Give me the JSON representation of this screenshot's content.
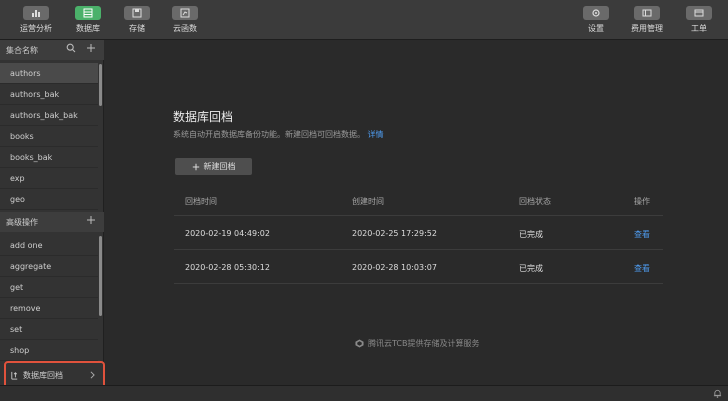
{
  "toolbar": {
    "left_buttons": [
      {
        "label": "运营分析",
        "icon": "bar-chart-icon",
        "active": false
      },
      {
        "label": "数据库",
        "icon": "database-icon",
        "active": true
      },
      {
        "label": "存储",
        "icon": "storage-icon",
        "active": false
      },
      {
        "label": "云函数",
        "icon": "function-icon",
        "active": false
      }
    ],
    "right_buttons": [
      {
        "label": "设置",
        "icon": "gear-icon"
      },
      {
        "label": "费用管理",
        "icon": "billing-icon"
      },
      {
        "label": "工单",
        "icon": "ticket-icon"
      }
    ]
  },
  "sidebar": {
    "collections_header": "集合名称",
    "collections": [
      "authors",
      "authors_bak",
      "authors_bak_bak",
      "books",
      "books_bak",
      "exp",
      "geo"
    ],
    "selected_collection": "authors",
    "advanced_header": "高级操作",
    "advanced_ops": [
      "add one",
      "aggregate",
      "get",
      "remove",
      "set",
      "shop"
    ],
    "backup_entry": "数据库回档"
  },
  "main": {
    "title": "数据库回档",
    "description": "系统自动开启数据库备份功能。新建回档可回档数据。",
    "details_link": "详情",
    "new_button": "新建回档",
    "table": {
      "headers": [
        "回档时间",
        "创建时间",
        "回档状态",
        "操作"
      ],
      "rows": [
        {
          "backup_time": "2020-02-19 04:49:02",
          "created_time": "2020-02-25 17:29:52",
          "status": "已完成",
          "action": "查看"
        },
        {
          "backup_time": "2020-02-28 05:30:12",
          "created_time": "2020-02-28 10:03:07",
          "status": "已完成",
          "action": "查看"
        }
      ]
    },
    "footer_note": "腾讯云TCB提供存储及计算服务"
  },
  "colors": {
    "accent_green": "#4bb16a",
    "link_blue": "#4e9cf0",
    "highlight_red": "#e0523c"
  }
}
